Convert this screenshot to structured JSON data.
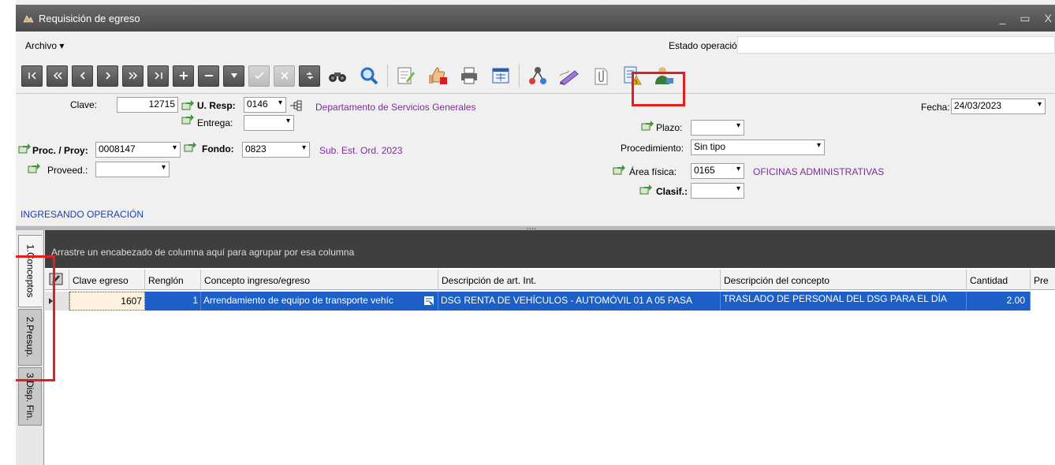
{
  "window": {
    "title": "Requisición de egreso",
    "min": "_",
    "max": "▭",
    "close": "X"
  },
  "menu": {
    "archivo": "Archivo ▾",
    "estado_label": "Estado operación",
    "estado_value": ""
  },
  "form": {
    "clave_label": "Clave:",
    "clave_value": "12715",
    "uresp_label": "U. Resp:",
    "uresp_value": "0146",
    "uresp_desc": "Departamento de Servicios Generales",
    "entrega_label": "Entrega:",
    "entrega_value": "",
    "proc_label": "Proc. / Proy:",
    "proc_value": "0008147",
    "fondo_label": "Fondo:",
    "fondo_value": "0823",
    "fondo_desc": "Sub. Est. Ord. 2023",
    "proveed_label": "Proveed.:",
    "proveed_value": "",
    "fecha_label": "Fecha:",
    "fecha_value": "24/03/2023",
    "plazo_label": "Plazo:",
    "plazo_value": "",
    "procedimiento_label": "Procedimiento:",
    "procedimiento_value": "Sin tipo",
    "area_label": "Área física:",
    "area_value": "0165",
    "area_desc": "OFICINAS ADMINISTRATIVAS",
    "clasif_label": "Clasif.:",
    "clasif_value": "",
    "status": "INGRESANDO OPERACIÓN"
  },
  "tabs": [
    "1.Conceptos",
    "2.Presup.",
    "3.Disp. Fin."
  ],
  "grid": {
    "group_hint": "Arrastre un encabezado de columna aquí para agrupar por esa columna",
    "columns": [
      "Clave egreso",
      "Renglón",
      "Concepto ingreso/egreso",
      "Descripción de art. Int.",
      "Descripción del concepto",
      "Cantidad",
      "Pre"
    ],
    "rows": [
      {
        "clave": "1607",
        "renglon": "1",
        "concepto": "Arrendamiento de equipo de transporte vehíc",
        "desc_art": "DSG RENTA DE VEHÍCULOS - AUTOMÓVIL 01 A 05 PASA",
        "desc_concepto": "TRASLADO DE PERSONAL DEL DSG PARA EL DÍA",
        "cantidad": "2.00",
        "pre": ""
      }
    ]
  },
  "colors": {
    "highlight": "#e02020",
    "selected_row": "#1c5fc7",
    "link_purple": "#7b2d9c",
    "titlebar": "#555555"
  }
}
